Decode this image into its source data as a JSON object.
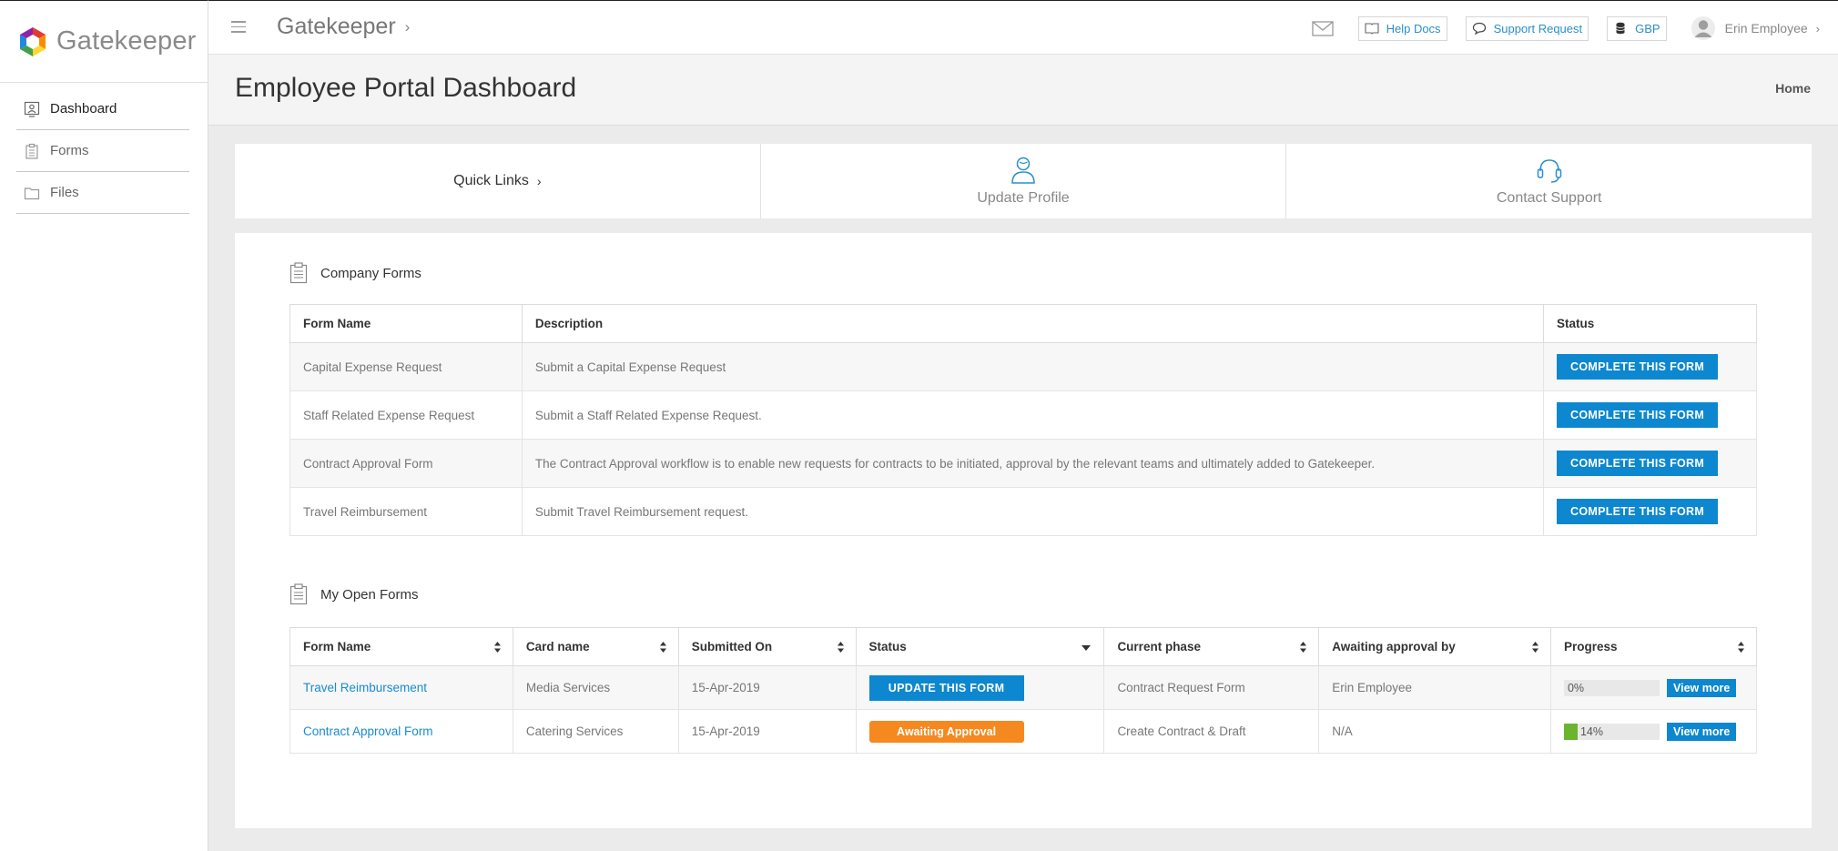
{
  "app": {
    "name": "Gatekeeper"
  },
  "sidebar": {
    "items": [
      {
        "label": "Dashboard",
        "icon": "dashboard-icon"
      },
      {
        "label": "Forms",
        "icon": "clipboard-icon"
      },
      {
        "label": "Files",
        "icon": "folder-icon"
      }
    ]
  },
  "topbar": {
    "title": "Gatekeeper",
    "help_docs": "Help Docs",
    "support_request": "Support Request",
    "currency": "GBP",
    "user_name": "Erin Employee"
  },
  "header": {
    "title": "Employee Portal Dashboard",
    "breadcrumb_home": "Home"
  },
  "quick_links": {
    "title": "Quick Links",
    "update_profile": "Update Profile",
    "contact_support": "Contact Support"
  },
  "company_forms": {
    "title": "Company Forms",
    "columns": [
      "Form Name",
      "Description",
      "Status"
    ],
    "button_label": "COMPLETE THIS FORM",
    "rows": [
      {
        "name": "Capital Expense Request",
        "description": "Submit a Capital Expense Request"
      },
      {
        "name": "Staff Related Expense Request",
        "description": "Submit a Staff Related Expense Request."
      },
      {
        "name": "Contract Approval Form",
        "description": "The Contract Approval workflow is to enable new requests for contracts to be initiated, approval by the relevant teams and ultimately added to Gatekeeper."
      },
      {
        "name": "Travel Reimbursement",
        "description": "Submit Travel Reimbursement request."
      }
    ]
  },
  "open_forms": {
    "title": "My Open Forms",
    "columns": [
      "Form Name",
      "Card name",
      "Submitted On",
      "Status",
      "Current phase",
      "Awaiting approval by",
      "Progress"
    ],
    "view_more": "View more",
    "rows": [
      {
        "name": "Travel Reimbursement",
        "card": "Media Services",
        "submitted": "15-Apr-2019",
        "status": "UPDATE THIS FORM",
        "phase": "Contract Request Form",
        "approver": "Erin Employee",
        "progress": "0%"
      },
      {
        "name": "Contract Approval Form",
        "card": "Catering Services",
        "submitted": "15-Apr-2019",
        "status": "Awaiting Approval",
        "phase": "Create Contract & Draft",
        "approver": "N/A",
        "progress": "14%"
      }
    ]
  },
  "colors": {
    "accent": "#0d87cf",
    "warning": "#f5891f",
    "progress": "#6bb42e"
  }
}
